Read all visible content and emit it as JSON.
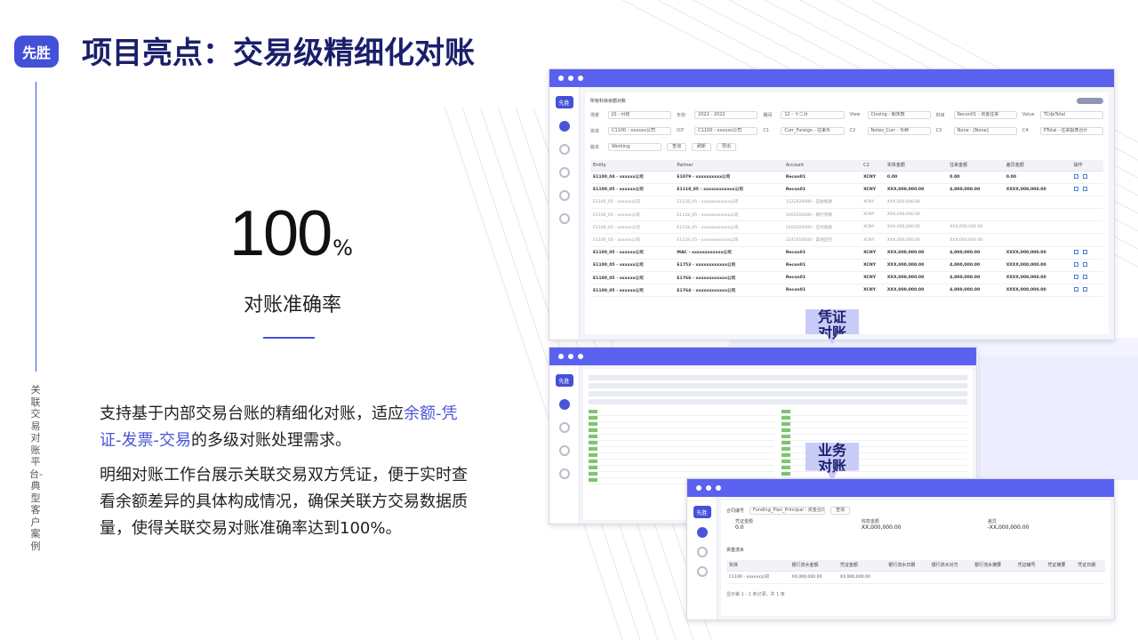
{
  "logo": "先胜",
  "title": "项目亮点：交易级精细化对账",
  "side_caption": "关联交易对账平台-典型客户案例",
  "stat": {
    "value": "100",
    "unit": "%",
    "label": "对账准确率"
  },
  "para1": {
    "before": "支持基于内部交易台账的精细化对账，适应",
    "highlight": "余额-凭证-发票-交易",
    "after": "的多级对账处理需求。"
  },
  "para2": "明细对账工作台展示关联交易双方凭证，便于实时查看余额差异的具体构成情况，确保关联方交易数据质量，使得关联交易对账准确率达到100%。",
  "bubbles": {
    "voucher": "凭证\n对账",
    "business": "业务\n对账"
  },
  "win1": {
    "logo": "先胜",
    "panel_title": "所有科目余额对账",
    "filters": [
      [
        {
          "label": "场景",
          "value": "JQ - 月结"
        },
        {
          "label": "年份",
          "value": "2022 - 2022"
        },
        {
          "label": "期间",
          "value": "12 - 十二月"
        },
        {
          "label": "View",
          "value": "Closing - 期末数"
        },
        {
          "label": "科目",
          "value": "Recon01 - 资金往来"
        },
        {
          "label": "Value",
          "value": "TCdpTotal"
        }
      ],
      [
        {
          "label": "实体",
          "value": "C1100 - xxxxxx公司"
        },
        {
          "label": "ICP",
          "value": "C1100 - xxxxxx公司"
        },
        {
          "label": "C1",
          "value": "Curr_Foreign - 往来币"
        },
        {
          "label": "C2",
          "value": "Notes_Curr - 币种"
        },
        {
          "label": "C3",
          "value": "None - [None]"
        },
        {
          "label": "C4",
          "value": "PTotal - 往来报表合计"
        }
      ]
    ],
    "version_label": "版本",
    "version": "Working",
    "buttons": [
      "查询",
      "刷新",
      "导出"
    ],
    "headers": [
      "Entity",
      "Partner",
      "Account",
      "C2",
      "实体金额",
      "往来金额",
      "差异金额",
      "操作"
    ],
    "rows": [
      {
        "entity": "E1100_04 - xxxxxx公司",
        "partner": "E1079 - xxxxxxxxxx公司",
        "account": "Recon01",
        "c2": "XCNY",
        "a": "0.00",
        "b": "0.00",
        "c": "0.00",
        "bold": true
      },
      {
        "entity": "E1100_05 - xxxxxx公司",
        "partner": "E1118_05 - xxxxxxxxxxxx公司",
        "account": "Recon01",
        "c2": "XCNY",
        "a": "XXX,000,000.00",
        "b": "4,000,000.00",
        "c": "XXXX,000,000.00",
        "bold": true
      },
      {
        "entity": "E1100_05 - xxxxxx公司",
        "partner": "E1118_05 - xxxxxxxxxxxx公司",
        "account": "1122020000 - 应收账款",
        "c2": "XCNY",
        "a": "XXX,000,000.00",
        "b": "",
        "c": "",
        "bold": false
      },
      {
        "entity": "E1100_05 - xxxxxx公司",
        "partner": "E1118_05 - xxxxxxxxxxxx公司",
        "account": "1002010000 - 银行存款",
        "c2": "XCNY",
        "a": "XXX,000,000.00",
        "b": "",
        "c": "",
        "bold": false
      },
      {
        "entity": "E1100_05 - xxxxxx公司",
        "partner": "E1118_05 - xxxxxxxxxxxx公司",
        "account": "2201020000 - 应付账款",
        "c2": "XCNY",
        "a": "XXX,000,000.00",
        "b": "XXX,000,000.00",
        "c": "",
        "bold": false
      },
      {
        "entity": "E1100_05 - xxxxxx公司",
        "partner": "E1118_05 - xxxxxxxxxxxx公司",
        "account": "2241010000 - 其他应付",
        "c2": "XCNY",
        "a": "XXX,000,000.00",
        "b": "XXX,000,000.00",
        "c": "",
        "bold": false
      },
      {
        "entity": "E1100_05 - xxxxxx公司",
        "partner": "MAC - xxxxxxxxxxxx公司",
        "account": "Recon01",
        "c2": "XCNY",
        "a": "XXX,000,000.00",
        "b": "4,000,000.00",
        "c": "XXXX,000,000.00",
        "bold": true
      },
      {
        "entity": "E1100_05 - xxxxxx公司",
        "partner": "E1753 - xxxxxxxxxxxx公司",
        "account": "Recon01",
        "c2": "XCNY",
        "a": "XXX,000,000.00",
        "b": "4,000,000.00",
        "c": "XXXX,000,000.00",
        "bold": true
      },
      {
        "entity": "E1100_05 - xxxxxx公司",
        "partner": "E1766 - xxxxxxxxxxxx公司",
        "account": "Recon01",
        "c2": "XCNY",
        "a": "XXX,000,000.00",
        "b": "4,000,000.00",
        "c": "XXXX,000,000.00",
        "bold": true
      },
      {
        "entity": "E1100_05 - xxxxxx公司",
        "partner": "E1764 - xxxxxxxxxxxx公司",
        "account": "Recon01",
        "c2": "XCNY",
        "a": "XXX,000,000.00",
        "b": "4,000,000.00",
        "c": "XXXX,000,000.00",
        "bold": true
      }
    ]
  },
  "win2": {
    "logo": "先胜"
  },
  "win3": {
    "logo": "先胜",
    "contract_label": "合同编号",
    "contract_value": "Funding_Plan_Principal - 资金合同",
    "query": "查询",
    "cards": [
      {
        "label": "凭证金额",
        "value": "0.0"
      },
      {
        "label": "收款金额",
        "value": "XX,000,000.00"
      },
      {
        "label": "差异",
        "value": "-XX,000,000.00"
      }
    ],
    "section": "资金流水",
    "headers": [
      "实体",
      "银行流水金额",
      "凭证金额",
      "银行流水日期",
      "银行流水对方",
      "银行流水摘要",
      "凭证编号",
      "凭证摘要",
      "凭证日期"
    ],
    "row": [
      "C1100 - xxxxxx公司",
      "XX,000,000.00",
      "XX,000,000.00",
      "",
      "",
      "",
      "",
      "",
      ""
    ],
    "footer": "显示第 1 - 1 条记录，共 1 条"
  }
}
